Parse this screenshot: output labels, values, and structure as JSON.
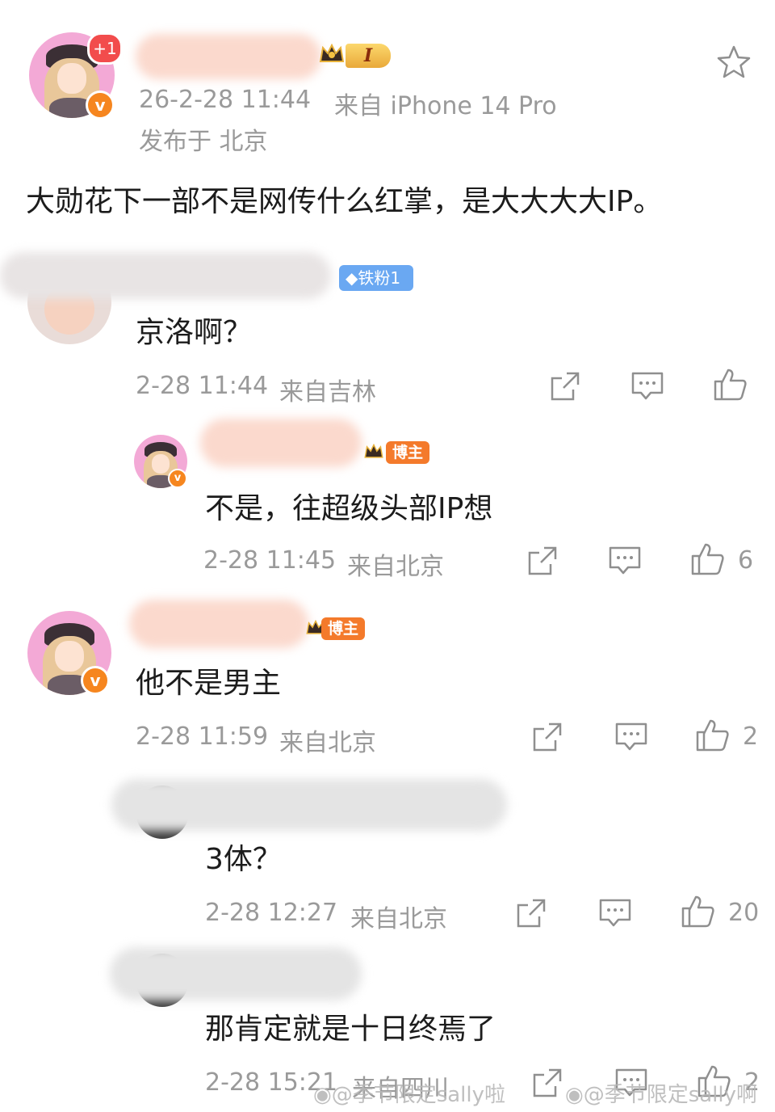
{
  "post": {
    "badge_plus": "+1",
    "level": "I",
    "time": "26-2-28 11:44",
    "source": "来自 iPhone 14 Pro",
    "location": "发布于 北京",
    "content": "大勋花下一部不是网传什么红掌，是大大大大IP。"
  },
  "comments": [
    {
      "badge": "铁粉1",
      "text": "京洛啊？",
      "time": "2-28 11:44",
      "source": "来自吉林",
      "likes": ""
    },
    {
      "badge": "博主",
      "text": "不是，往超级头部IP想",
      "time": "2-28 11:45",
      "source": "来自北京",
      "likes": "6"
    },
    {
      "badge": "博主",
      "text": "他不是男主",
      "time": "2-28 11:59",
      "source": "来自北京",
      "likes": "2"
    },
    {
      "badge": "",
      "text": "3体？",
      "time": "2-28 12:27",
      "source": "来自北京",
      "likes": "20"
    },
    {
      "badge": "",
      "text": "那肯定就是十日终焉了",
      "time": "2-28 15:21",
      "source": "来自四川",
      "likes": "2"
    }
  ],
  "watermarks": [
    "@季节限定sally啦",
    "@季节限定sally啊"
  ],
  "icons": {
    "star": "star-icon",
    "share": "share-icon",
    "reply": "comment-icon",
    "like": "thumbs-up-icon"
  },
  "colors": {
    "accent_orange": "#f47a2b",
    "fan_badge": "#6aa8f2",
    "meta_gray": "#9a9a9a"
  }
}
